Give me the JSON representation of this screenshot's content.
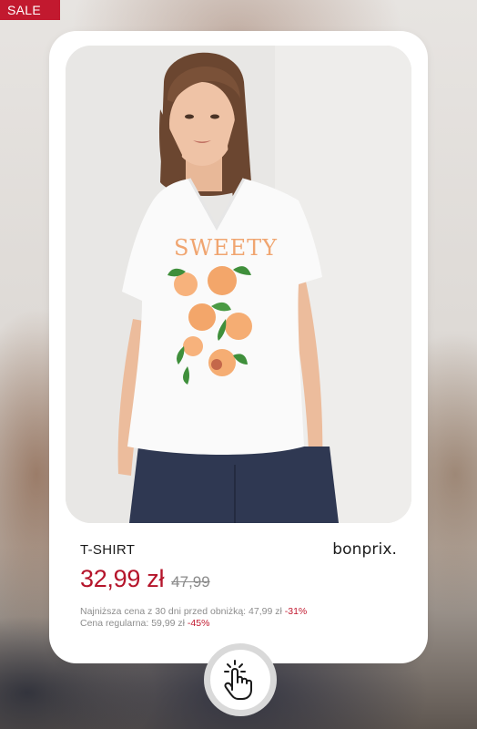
{
  "badge": {
    "label": "SALE",
    "color": "#c2192f"
  },
  "product": {
    "image_icon": "product-photo-woman-t-shirt",
    "graphic_text": "SWEETY",
    "name": "T-SHIRT",
    "brand": "bonprix."
  },
  "price": {
    "current": "32,99 zł",
    "old": "47,99",
    "color": "#b5152b"
  },
  "notes": {
    "lowest_label": "Najniższa cena z 30 dni przed obniżką: 47,99 zł",
    "lowest_discount": "-31%",
    "regular_label": "Cena regularna: 59,99 zł",
    "regular_discount": "-45%"
  },
  "tap": {
    "icon": "tap-hand-icon"
  }
}
